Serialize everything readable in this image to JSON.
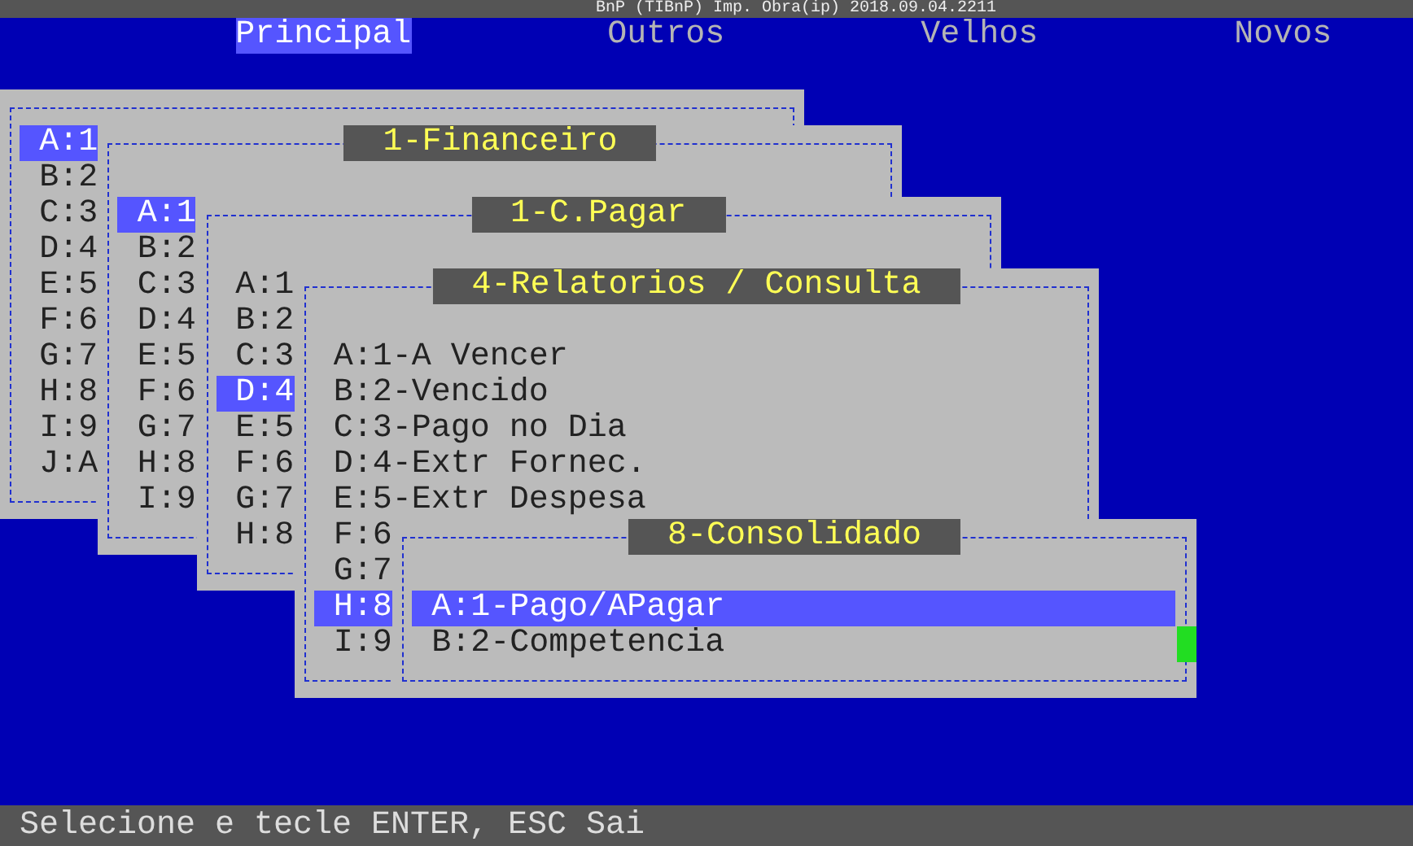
{
  "title_bar": {
    "title": "BnP (TIBnP) Imp. Obra(ip) 2018.09.04.2211"
  },
  "menu": [
    {
      "label": "Principal",
      "selected": true
    },
    {
      "label": "Outros",
      "selected": false
    },
    {
      "label": "Velhos",
      "selected": false
    },
    {
      "label": "Novos",
      "selected": false
    }
  ],
  "windows": [
    {
      "items": [
        {
          "label": "A:1",
          "selected": true
        },
        {
          "label": "B:2",
          "selected": false
        },
        {
          "label": "C:3",
          "selected": false
        },
        {
          "label": "D:4",
          "selected": false
        },
        {
          "label": "E:5",
          "selected": false
        },
        {
          "label": "F:6",
          "selected": false
        },
        {
          "label": "G:7",
          "selected": false
        },
        {
          "label": "H:8",
          "selected": false
        },
        {
          "label": "I:9",
          "selected": false
        },
        {
          "label": "J:A",
          "selected": false
        }
      ]
    },
    {
      "title": "1-Financeiro",
      "items": [
        {
          "label": "A:1",
          "selected": true
        },
        {
          "label": "B:2",
          "selected": false
        },
        {
          "label": "C:3",
          "selected": false
        },
        {
          "label": "D:4",
          "selected": false
        },
        {
          "label": "E:5",
          "selected": false
        },
        {
          "label": "F:6",
          "selected": false
        },
        {
          "label": "G:7",
          "selected": false
        },
        {
          "label": "H:8",
          "selected": false
        },
        {
          "label": "I:9",
          "selected": false
        }
      ]
    },
    {
      "title": "1-C.Pagar",
      "items": [
        {
          "label": "A:1",
          "selected": false
        },
        {
          "label": "B:2",
          "selected": false
        },
        {
          "label": "C:3",
          "selected": false
        },
        {
          "label": "D:4",
          "selected": true
        },
        {
          "label": "E:5",
          "selected": false
        },
        {
          "label": "F:6",
          "selected": false
        },
        {
          "label": "G:7",
          "selected": false
        },
        {
          "label": "H:8",
          "selected": false
        }
      ]
    },
    {
      "title": "4-Relatorios / Consulta",
      "items": [
        {
          "label": "A:1-A Vencer",
          "selected": false
        },
        {
          "label": "B:2-Vencido",
          "selected": false
        },
        {
          "label": "C:3-Pago no Dia",
          "selected": false
        },
        {
          "label": "D:4-Extr Fornec.",
          "selected": false
        },
        {
          "label": "E:5-Extr Despesa",
          "selected": false
        },
        {
          "label": "F:6",
          "selected": false
        },
        {
          "label": "G:7",
          "selected": false
        },
        {
          "label": "H:8",
          "selected": true
        },
        {
          "label": "I:9",
          "selected": false
        }
      ]
    },
    {
      "title": "8-Consolidado",
      "items": [
        {
          "label": "A:1-Pago/APagar",
          "selected": true
        },
        {
          "label": "B:2-Competencia",
          "selected": false
        }
      ]
    }
  ],
  "status_bar": {
    "text": "Selecione e tecle ENTER, ESC Sai"
  }
}
